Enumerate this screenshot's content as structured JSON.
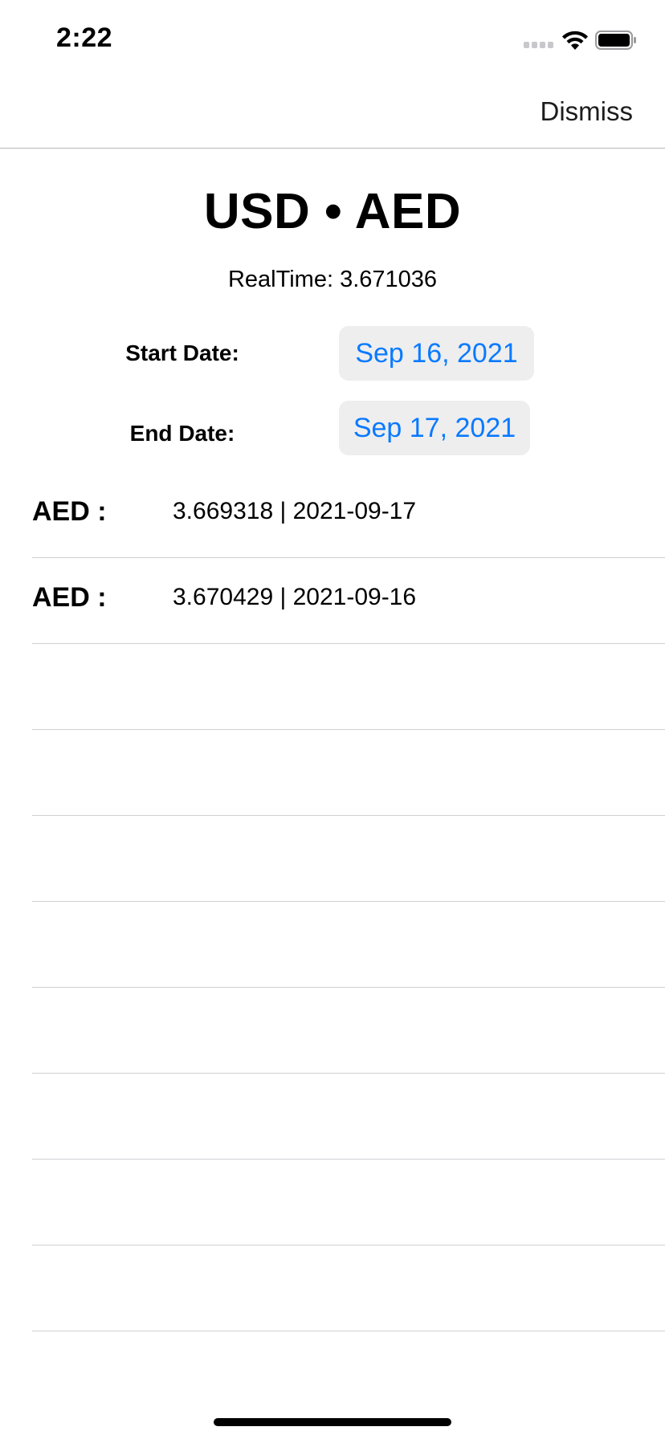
{
  "status_bar": {
    "time": "2:22"
  },
  "nav": {
    "dismiss_label": "Dismiss"
  },
  "header": {
    "base": "USD",
    "separator": "•",
    "quote": "AED",
    "realtime_label": "RealTime:",
    "realtime_value": "3.671036"
  },
  "dates": {
    "start_label": "Start Date:",
    "start_value": "Sep 16, 2021",
    "end_label": "End Date:",
    "end_value": "Sep 17, 2021"
  },
  "rates": [
    {
      "code": "AED :",
      "value": "3.669318 | 2021-09-17"
    },
    {
      "code": "AED :",
      "value": "3.670429 | 2021-09-16"
    },
    {
      "code": "",
      "value": ""
    },
    {
      "code": "",
      "value": ""
    },
    {
      "code": "",
      "value": ""
    },
    {
      "code": "",
      "value": ""
    },
    {
      "code": "",
      "value": ""
    },
    {
      "code": "",
      "value": ""
    },
    {
      "code": "",
      "value": ""
    },
    {
      "code": "",
      "value": ""
    }
  ],
  "colors": {
    "accent": "#0a7aff",
    "pill_bg": "#eeeeef",
    "separator": "#d0d0d4"
  }
}
